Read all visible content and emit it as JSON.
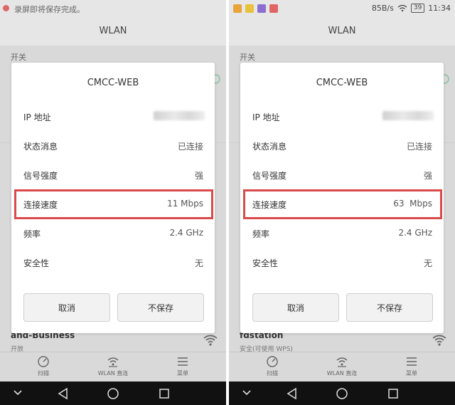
{
  "panels": [
    {
      "status_text": "录屏即将保存完成。",
      "status_right": null,
      "title": "WLAN",
      "section_label": "开关",
      "dialog": {
        "title": "CMCC-WEB",
        "rows": [
          {
            "label": "IP 地址",
            "value": ""
          },
          {
            "label": "状态消息",
            "value": "已连接"
          },
          {
            "label": "信号强度",
            "value": "强"
          },
          {
            "label": "连接速度",
            "value": "11 Mbps"
          },
          {
            "label": "频率",
            "value": "2.4 GHz"
          },
          {
            "label": "安全性",
            "value": "无"
          }
        ],
        "cancel_label": "取消",
        "nosave_label": "不保存"
      },
      "network": {
        "name": "and-Business",
        "sub": "开放"
      },
      "nav": [
        "扫描",
        "WLAN 直连",
        "菜单"
      ]
    },
    {
      "status_text": "",
      "status_right": {
        "speed": "85B/s",
        "battery": "39",
        "time": "11:34"
      },
      "title": "WLAN",
      "section_label": "开关",
      "dialog": {
        "title": "CMCC-WEB",
        "rows": [
          {
            "label": "IP 地址",
            "value": ""
          },
          {
            "label": "状态消息",
            "value": "已连接"
          },
          {
            "label": "信号强度",
            "value": "强"
          },
          {
            "label": "连接速度",
            "value": "63  Mbps"
          },
          {
            "label": "频率",
            "value": "2.4 GHz"
          },
          {
            "label": "安全性",
            "value": "无"
          }
        ],
        "cancel_label": "取消",
        "nosave_label": "不保存"
      },
      "network": {
        "name": "fdstation",
        "sub": "安全(可使用 WPS)"
      },
      "nav": [
        "扫描",
        "WLAN 直连",
        "菜单"
      ]
    }
  ],
  "colors": {
    "highlight": "#d94a4a",
    "accent": "#6fb98f"
  }
}
